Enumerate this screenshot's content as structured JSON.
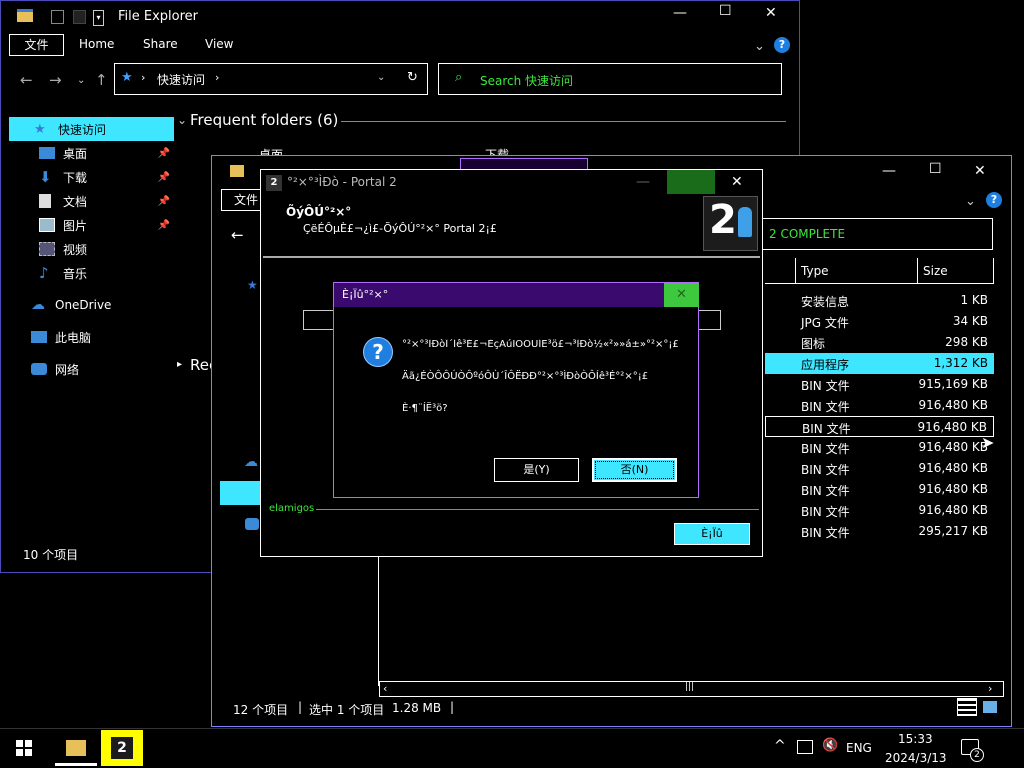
{
  "explorer1": {
    "title": "File Explorer",
    "ribbon_tabs": [
      "文件",
      "Home",
      "Share",
      "View"
    ],
    "address_current": "快速访问",
    "search_placeholder": "Search 快速访问",
    "section_frequent": "Frequent folders (6)",
    "nav": [
      {
        "label": "快速访问",
        "icon": "star-icon",
        "selected": true
      },
      {
        "label": "桌面",
        "icon": "desktop-icon",
        "pinned": true
      },
      {
        "label": "下载",
        "icon": "download-icon",
        "pinned": true
      },
      {
        "label": "文档",
        "icon": "documents-icon",
        "pinned": true
      },
      {
        "label": "图片",
        "icon": "pictures-icon",
        "pinned": true
      },
      {
        "label": "视频",
        "icon": "videos-icon"
      },
      {
        "label": "音乐",
        "icon": "music-icon"
      },
      {
        "label": "OneDrive",
        "icon": "cloud-icon"
      },
      {
        "label": "此电脑",
        "icon": "computer-icon"
      },
      {
        "label": "网络",
        "icon": "network-icon"
      }
    ],
    "frequent_visible": [
      "桌面",
      "下载"
    ],
    "status": "10 个项目"
  },
  "explorer2": {
    "title_partial": "Portal 2 COMPLETE",
    "ribbon_partial": "文件",
    "search_partial": "2 COMPLETE",
    "columns": {
      "type": "Type",
      "size": "Size"
    },
    "rows": [
      {
        "type": "安装信息",
        "size": "1 KB"
      },
      {
        "type": "JPG 文件",
        "size": "34 KB"
      },
      {
        "type": "图标",
        "size": "298 KB"
      },
      {
        "type": "应用程序",
        "size": "1,312 KB",
        "selected": true
      },
      {
        "type": "BIN 文件",
        "size": "915,169 KB"
      },
      {
        "type": "BIN 文件",
        "size": "916,480 KB"
      },
      {
        "type": "BIN 文件",
        "size": "916,480 KB",
        "focused": true
      },
      {
        "type": "BIN 文件",
        "size": "916,480 KB"
      },
      {
        "type": "BIN 文件",
        "size": "916,480 KB"
      },
      {
        "type": "BIN 文件",
        "size": "916,480 KB"
      },
      {
        "type": "BIN 文件",
        "size": "916,480 KB"
      },
      {
        "type": "BIN 文件",
        "size": "295,217 KB"
      }
    ],
    "status_items": "12 个项目",
    "status_selected": "选中 1 个项目",
    "status_size": "1.28 MB"
  },
  "setup": {
    "title": "°²×°³ÌÐò - Portal 2",
    "header_title": "ÕýÔÚ°²×°",
    "header_sub": "ÇëÉÔµÈ£¬¿ì£-ÕýÔÚ°²×° Portal 2¡£",
    "footer_brand": "elamigos",
    "cancel_label": "È¡Ïû",
    "logo_text": "2"
  },
  "dialog": {
    "title": "È¡Ïû°²×°",
    "line1": "°²×°³ÌÐòÎ´Íê³É£¬ÈçÄúÏÖÔÚÍË³ö£¬³ÌÐò½«²»»á±»°²×°¡£",
    "line2": "Äã¿ÉÒÔÔÚÒÔºóÔÙ´ÎÔËÐÐ°²×°³ÌÐòÒÔÍê³É°²×°¡£",
    "line3": "È·¶¨ÍË³ö?",
    "yes_label": "是(Y)",
    "no_label": "否(N)"
  },
  "taskbar": {
    "lang": "ENG",
    "time": "15:33",
    "date": "2024/3/13",
    "notif_count": "2"
  },
  "colors": {
    "accent": "#3ee6ff",
    "window_border": "#7f7fff",
    "dialog_title_bg": "#3a0a6e",
    "dialog_border": "#b06cff",
    "green": "#3ee63e",
    "help_blue": "#1e7fe0"
  }
}
